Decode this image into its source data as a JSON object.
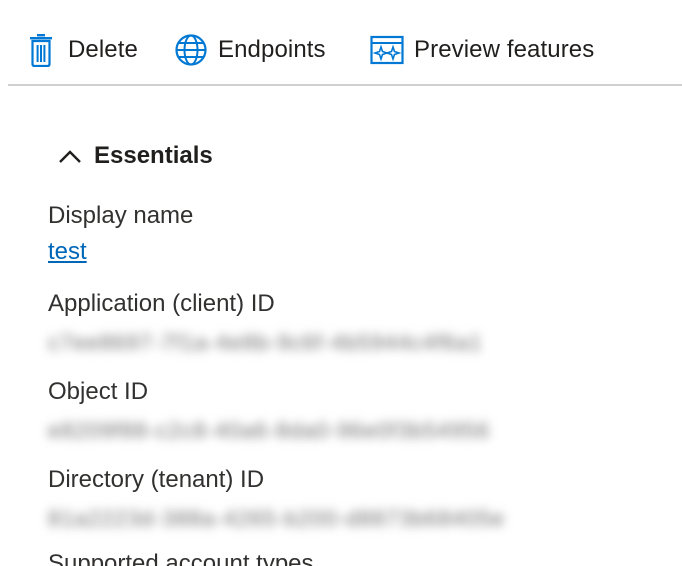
{
  "toolbar": {
    "delete_label": "Delete",
    "endpoints_label": "Endpoints",
    "preview_label": "Preview features"
  },
  "essentials": {
    "title": "Essentials",
    "display_name_label": "Display name",
    "display_name_value": "test",
    "client_id_label": "Application (client) ID",
    "client_id_value": "c7ee8697-7f1a-4e8b-9c6f-4b5944c4f6a1",
    "object_id_label": "Object ID",
    "object_id_value": "e8209f88-c2c8-40a6-8da0-96e0f3b54956",
    "tenant_id_label": "Directory (tenant) ID",
    "tenant_id_value": "81a2223d-388a-4265-b200-d8873b68405e",
    "supported_label": "Supported account types"
  },
  "colors": {
    "accent": "#0078d4",
    "link": "#0067b8",
    "divider": "#d2d0ce"
  },
  "icons": {
    "delete": "trash-icon",
    "endpoints": "globe-icon",
    "preview": "preview-features-icon",
    "collapse": "chevron-up-icon"
  }
}
